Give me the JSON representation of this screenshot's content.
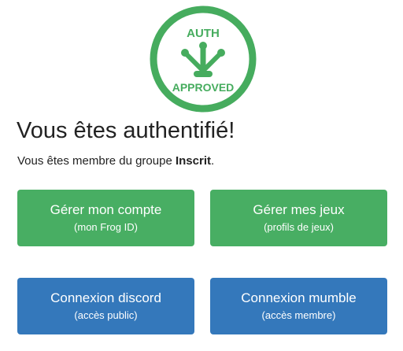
{
  "logo": {
    "top_text": "AUTH",
    "bottom_text": "APPROVED",
    "icon": "frog-foot-icon",
    "color": "#46ac5e"
  },
  "page": {
    "title": "Vous êtes authentifié!",
    "membership_prefix": "Vous êtes membre du groupe ",
    "group_name": "Inscrit",
    "membership_suffix": "."
  },
  "buttons": {
    "account": {
      "label": "Gérer mon compte",
      "sublabel": "(mon Frog ID)"
    },
    "games": {
      "label": "Gérer mes jeux",
      "sublabel": "(profils de jeux)"
    },
    "discord": {
      "label": "Connexion discord",
      "sublabel": "(accès public)"
    },
    "mumble": {
      "label": "Connexion mumble",
      "sublabel": "(accès membre)"
    }
  },
  "colors": {
    "green_button": "#48ae63",
    "blue_button": "#3478bb",
    "text": "#222222"
  }
}
